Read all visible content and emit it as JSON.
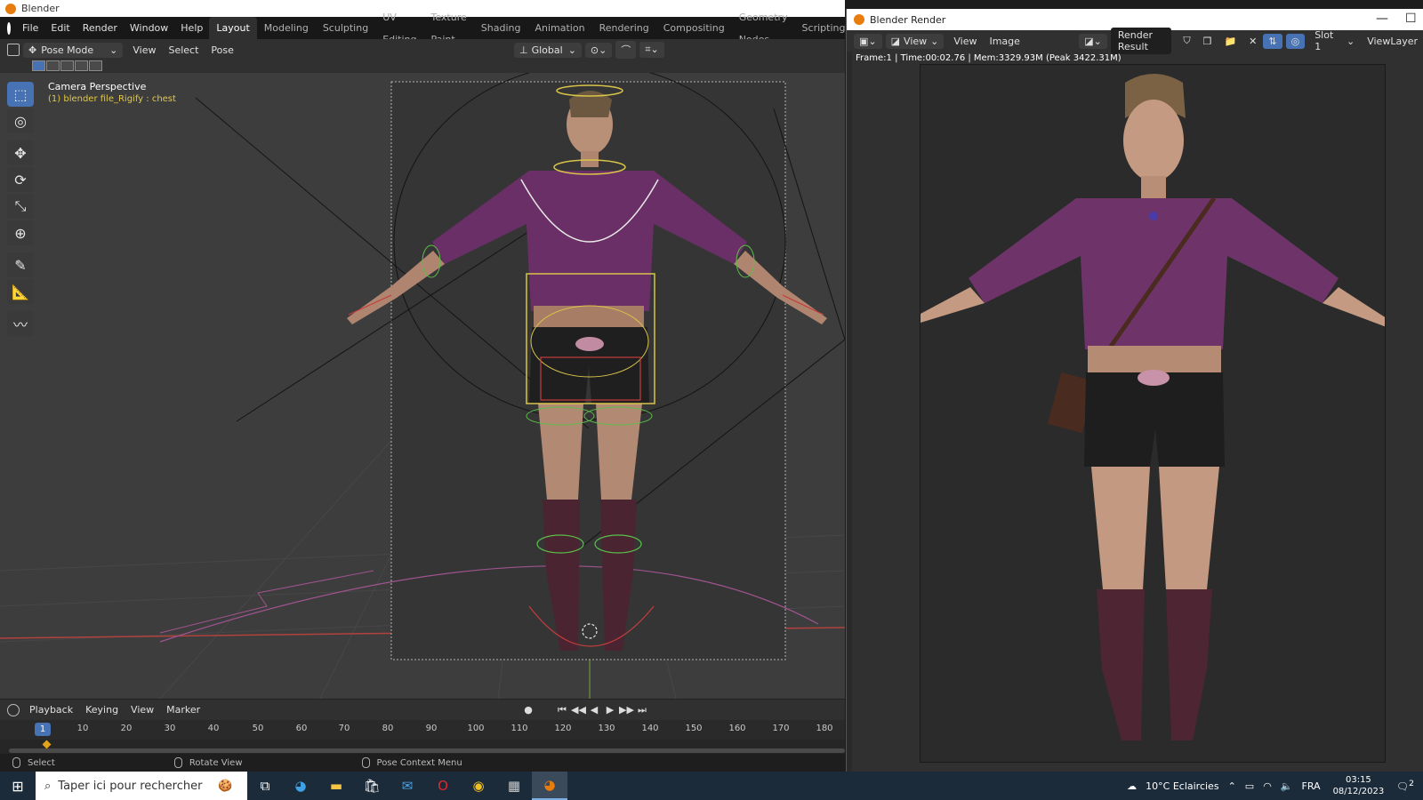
{
  "main_window": {
    "title": "Blender",
    "menus": [
      "File",
      "Edit",
      "Render",
      "Window",
      "Help"
    ],
    "workspaces": [
      "Layout",
      "Modeling",
      "Sculpting",
      "UV Editing",
      "Texture Paint",
      "Shading",
      "Animation",
      "Rendering",
      "Compositing",
      "Geometry Nodes",
      "Scripting",
      "+"
    ],
    "active_workspace": "Layout",
    "header": {
      "mode": "Pose Mode",
      "menus": [
        "View",
        "Select",
        "Pose"
      ],
      "orientation": "Global"
    },
    "viewport": {
      "label": "Camera Perspective",
      "sublabel": "(1) blender file_Rigify : chest"
    },
    "toolbar_icons": [
      "select-box-icon",
      "cursor-icon",
      "move-icon",
      "rotate-icon",
      "scale-icon",
      "transform-icon",
      "annotate-icon",
      "measure-icon",
      "relax-icon"
    ]
  },
  "timeline": {
    "menus": [
      "Playback",
      "Keying",
      "View",
      "Marker"
    ],
    "current_frame": "1",
    "ticks": [
      "10",
      "20",
      "30",
      "40",
      "50",
      "60",
      "70",
      "80",
      "90",
      "100",
      "110",
      "120",
      "130",
      "140",
      "150",
      "160",
      "170",
      "180"
    ]
  },
  "statusbar": {
    "items": [
      "Select",
      "Rotate View",
      "Pose Context Menu"
    ]
  },
  "render_window": {
    "title": "Blender Render",
    "menus": [
      "View",
      "View",
      "Image"
    ],
    "image_name": "Render Result",
    "slot": "Slot 1",
    "view_layer": "ViewLayer",
    "info": "Frame:1 | Time:00:02.76 | Mem:3329.93M (Peak 3422.31M)"
  },
  "taskbar": {
    "search_placeholder": "Taper ici pour rechercher",
    "weather": "10°C  Eclaircies",
    "language": "FRA",
    "time": "03:15",
    "date": "08/12/2023",
    "notification_count": "2"
  },
  "colors": {
    "accent": "#4772b3",
    "blender_orange": "#e87d0d",
    "bone_yellow": "#e2c84a"
  }
}
